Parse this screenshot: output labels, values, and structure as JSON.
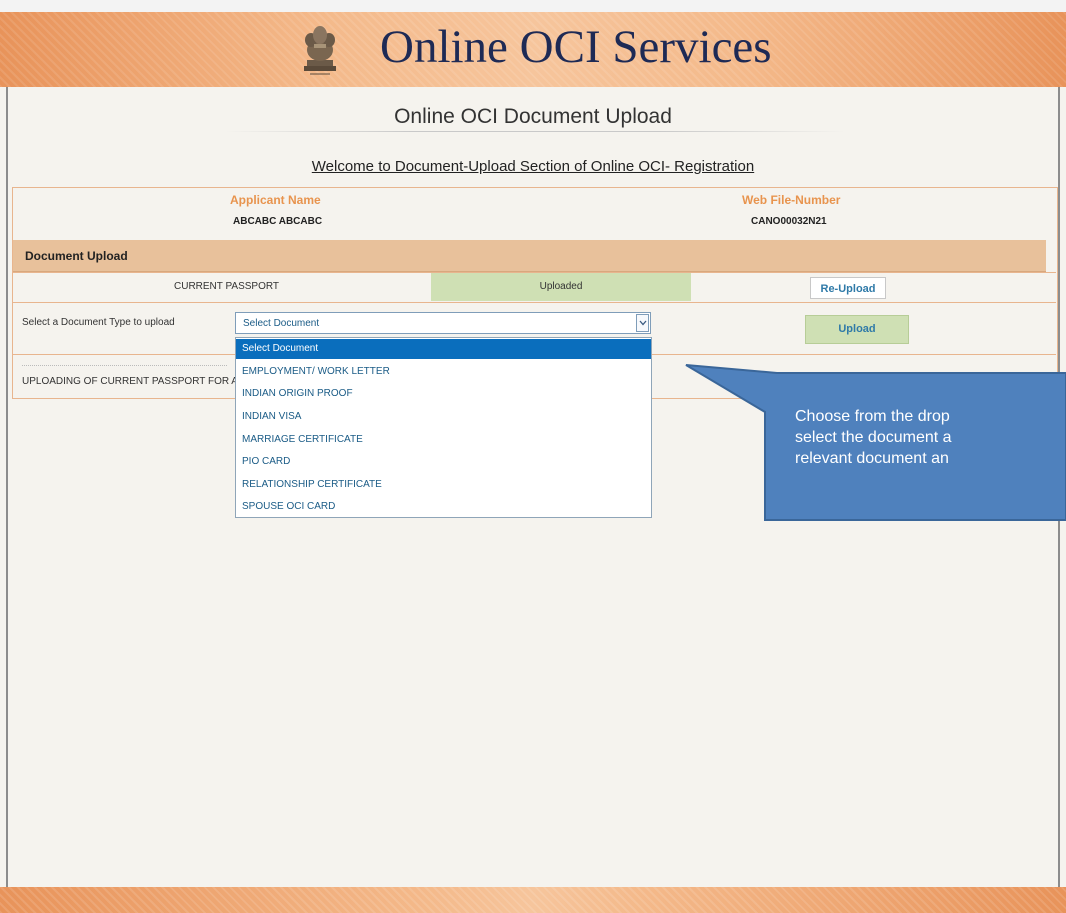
{
  "header": {
    "title": "Online OCI Services",
    "emblem_icon": "national-emblem-icon"
  },
  "page": {
    "heading": "Online OCI Document Upload",
    "welcome": "Welcome to Document-Upload Section of Online OCI- Registration"
  },
  "applicant": {
    "name_label": "Applicant Name",
    "name_value": "ABCABC ABCABC",
    "file_label": "Web File-Number",
    "file_value": "CANO00032N21"
  },
  "document_upload": {
    "section_title": "Document Upload",
    "current_doc": "CURRENT PASSPORT",
    "status": "Uploaded",
    "reupload_label": "Re-Upload",
    "select_label": "Select a Document Type to upload",
    "select_value": "Select Document",
    "upload_label": "Upload",
    "uploading_text": "UPLOADING OF CURRENT PASSPORT FOR ABC"
  },
  "dropdown": {
    "options": [
      "Select Document",
      "EMPLOYMENT/ WORK LETTER",
      "INDIAN ORIGIN PROOF",
      "INDIAN VISA",
      "MARRIAGE CERTIFICATE",
      "PIO CARD",
      "RELATIONSHIP CERTIFICATE",
      "SPOUSE OCI CARD"
    ],
    "selected_index": 0
  },
  "callout": {
    "lines": [
      "Choose from the drop",
      "select the document a",
      "relevant document an"
    ]
  },
  "colors": {
    "accent_orange": "#e8944e",
    "callout_blue": "#4f81bd",
    "selected_blue": "#0a6ebd",
    "uploaded_green": "#cfe0b4",
    "title_navy": "#1e2a55"
  }
}
